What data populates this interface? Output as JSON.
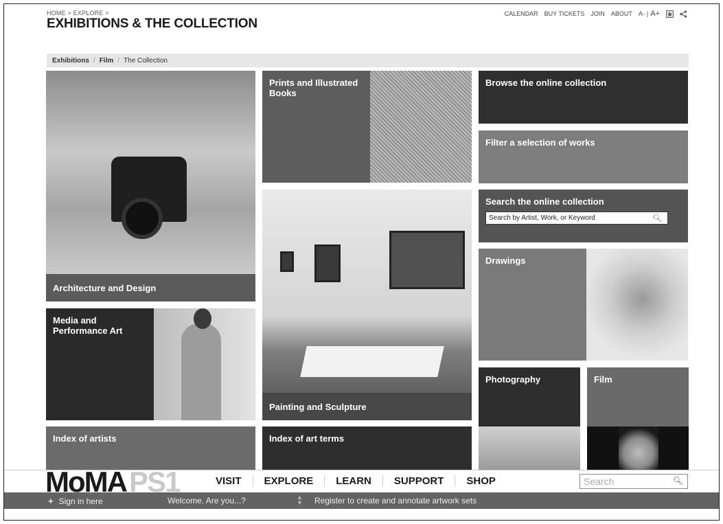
{
  "breadcrumb": "HOME > EXPLORE >",
  "utility": {
    "links": [
      "CALENDAR",
      "BUY TICKETS",
      "JOIN",
      "ABOUT"
    ],
    "font_smaller": "A-",
    "font_divider": "|",
    "font_larger": "A+"
  },
  "page_title": "EXHIBITIONS & THE COLLECTION",
  "subnav": [
    "Exhibitions",
    "Film",
    "The Collection"
  ],
  "tiles": {
    "architecture": "Architecture and Design",
    "prints": "Prints and Illustrated Books",
    "browse": "Browse the online collection",
    "filter": "Filter a selection of works",
    "search": "Search the online collection",
    "search_placeholder": "Search by Artist, Work, or Keyword",
    "painting": "Painting and Sculpture",
    "drawings": "Drawings",
    "media": "Media and Performance Art",
    "photography": "Photography",
    "film": "Film",
    "artists": "Index of artists",
    "terms": "Index of art terms"
  },
  "logo": {
    "moma": "MoMA",
    "ps1": "PS1"
  },
  "mainnav": [
    "VISIT",
    "EXPLORE",
    "LEARN",
    "SUPPORT",
    "SHOP"
  ],
  "global_search_placeholder": "Search",
  "memberbar": {
    "plus": "+",
    "signin": "Sign in here",
    "welcome": "Welcome. Are you...?",
    "register": "Register to create and annotate artwork sets"
  }
}
